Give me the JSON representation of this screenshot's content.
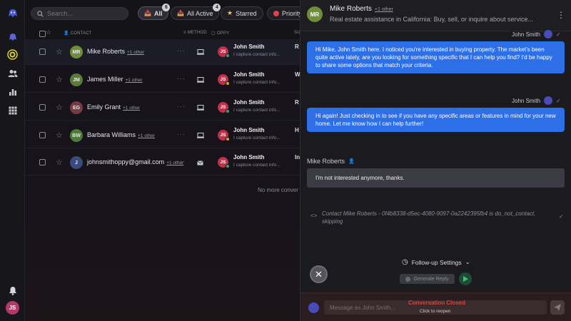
{
  "search": {
    "placeholder": "Search..."
  },
  "filters": [
    {
      "label": "All",
      "badge": "6",
      "icon": "inbox-icon"
    },
    {
      "label": "All Active",
      "badge": "4",
      "icon": "inbox-icon"
    },
    {
      "label": "Starred",
      "icon": "star-icon"
    },
    {
      "label": "Priority",
      "icon": "priority-icon"
    }
  ],
  "table": {
    "headers": {
      "contact": "CONTACT",
      "method": "METHOD",
      "copy": "OPPY",
      "extra": "SU"
    }
  },
  "rows": [
    {
      "initials": "MR",
      "avatar_color": "#6f8e3a",
      "name": "Mike Roberts",
      "other": "+1 other",
      "method": "desktop",
      "copy_name": "John Smith",
      "copy_sub": "I capture contact info...",
      "trunc": "R",
      "status_color": "#3ba56a"
    },
    {
      "initials": "JM",
      "avatar_color": "#5b7a3a",
      "name": "James Miller",
      "other": "+1 other",
      "method": "desktop",
      "copy_name": "John Smith",
      "copy_sub": "I capture contact info...",
      "trunc": "W",
      "status_color": "#e0a32a"
    },
    {
      "initials": "EG",
      "avatar_color": "#7a3a45",
      "name": "Emily Grant",
      "other": "+1 other",
      "method": "desktop",
      "copy_name": "John Smith",
      "copy_sub": "I capture contact info...",
      "trunc": "R",
      "status_color": "#3ba56a"
    },
    {
      "initials": "BW",
      "avatar_color": "#4d7a3a",
      "name": "Barbara Williams",
      "other": "+1 other",
      "method": "desktop",
      "copy_name": "John Smith",
      "copy_sub": "I capture contact info...",
      "trunc": "H",
      "status_color": "#e0a32a"
    },
    {
      "initials": "J",
      "avatar_color": "#3a4a7a",
      "name": "johnsmithoppy@gmail.com",
      "other": "+1 other",
      "method": "email",
      "copy_name": "John Smith",
      "copy_sub": "I capture contact info...",
      "trunc": "In",
      "status_color": "#3ba56a"
    }
  ],
  "no_more": "No more conver",
  "user": {
    "initials": "JS"
  },
  "conversation": {
    "contact_initials": "MR",
    "contact_name": "Mike Roberts",
    "contact_other": "+1 other",
    "description": "Real estate assistance in California: Buy, sell, or inquire about service...",
    "messages": [
      {
        "sender": "John Smith",
        "text": "Hi Mike, John Smith here. I noticed you're interested in buying property. The market's been quite active lately, are you looking for something specific that I can help you find? I'd be happy to share some options that match your criteria."
      },
      {
        "sender": "John Smith",
        "text": "Hi again! Just checking in to see if you have any specific areas or features in mind for your new home. Let me know how I can help further!"
      }
    ],
    "incoming": {
      "sender": "Mike Roberts",
      "text": "I'm not interested anymore, thanks."
    },
    "system_note": "Contact Mike Roberts - 0f4b8338-d5ec-4080-9097-0a2242395fb4 is do_not_contact, skipping",
    "followup_label": "Follow-up Settings",
    "generate_label": "Generate Reply",
    "composer_placeholder": "Message as John Smith...",
    "closed_title": "Conversation Closed",
    "closed_sub": "Click to reopen"
  }
}
